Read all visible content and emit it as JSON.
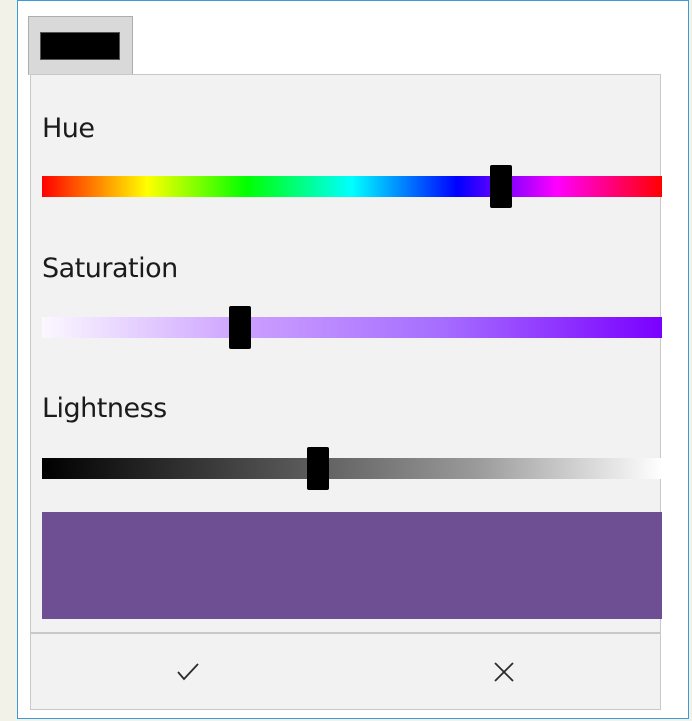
{
  "colors": {
    "selected": "#000000",
    "preview": "#6f4f93",
    "window_border": "#3c9ad8"
  },
  "picker": {
    "hue": {
      "label": "Hue",
      "value_fraction": 0.74
    },
    "saturation": {
      "label": "Saturation",
      "value_fraction": 0.32
    },
    "lightness": {
      "label": "Lightness",
      "value_fraction": 0.445
    }
  },
  "actions": {
    "accept_icon": "checkmark-icon",
    "cancel_icon": "close-icon"
  }
}
